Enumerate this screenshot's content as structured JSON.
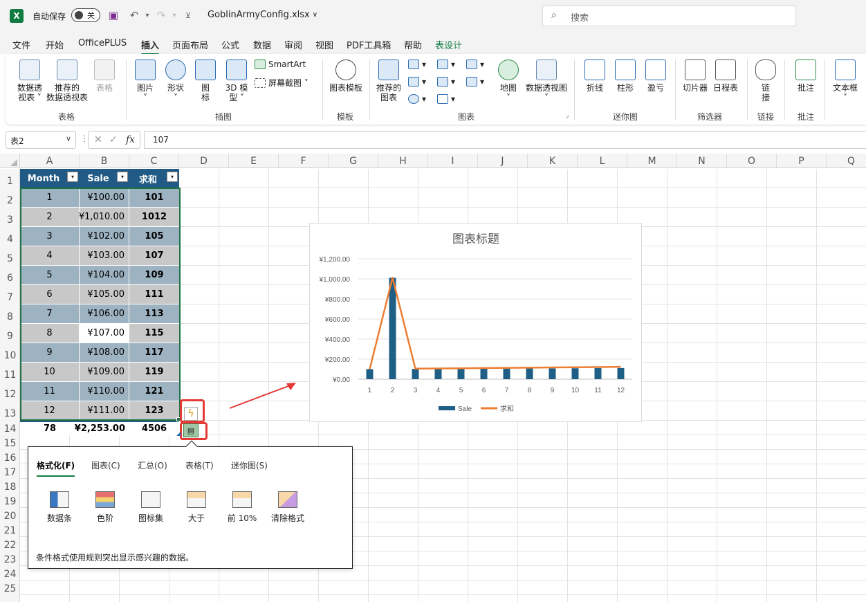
{
  "titlebar": {
    "logo": "X",
    "autosave_label": "自动保存",
    "autosave_state": "关",
    "filename": "GoblinArmyConfig.xlsx",
    "filename_chevron": "∨",
    "search_placeholder": "搜索"
  },
  "menu": {
    "tabs": [
      "文件",
      "开始",
      "OfficePLUS",
      "插入",
      "页面布局",
      "公式",
      "数据",
      "审阅",
      "视图",
      "PDF工具箱",
      "帮助",
      "表设计"
    ],
    "active": "插入"
  },
  "ribbon": {
    "groups": {
      "tables": "表格",
      "illustrations": "插图",
      "templates": "模板",
      "charts": "图表",
      "sparklines": "迷你图",
      "filters": "筛选器",
      "links": "链接",
      "comments": "批注"
    },
    "buttons": {
      "pivot_table": "数据透\n视表 ˅",
      "recommended_pivot": "推荐的\n数据透视表",
      "table": "表格",
      "pictures": "图片\n˅",
      "shapes": "形状\n˅",
      "icons": "图\n标",
      "models_3d": "3D 模\n型 ˅",
      "smartart": "SmartArt",
      "screenshot": "屏幕截图 ˅",
      "chart_templates": "图表模板",
      "recommended_charts": "推荐的\n图表",
      "maps": "地图\n˅",
      "pivot_chart": "数据透视图\n˅",
      "line": "折线",
      "column": "柱形",
      "win_loss": "盈亏",
      "slicer": "切片器",
      "timeline": "日程表",
      "link": "链\n接",
      "comment": "批注",
      "textbox": "文本框\n˅"
    }
  },
  "formula_bar": {
    "name_box": "表2",
    "name_box_arrow": "∨",
    "cancel": "✕",
    "enter": "✓",
    "fx": "fx",
    "value": "107"
  },
  "columns": [
    "A",
    "B",
    "C",
    "D",
    "E",
    "F",
    "G",
    "H",
    "I",
    "J",
    "K",
    "L",
    "M",
    "N",
    "O",
    "P",
    "Q"
  ],
  "rows": [
    "1",
    "2",
    "3",
    "4",
    "5",
    "6",
    "7",
    "8",
    "9",
    "10",
    "11",
    "12",
    "13",
    "14",
    "15",
    "16",
    "17",
    "18",
    "19",
    "20",
    "21",
    "22",
    "23",
    "24",
    "25"
  ],
  "table": {
    "headers": [
      "Month",
      "Sale",
      "求和"
    ],
    "filter_glyph": "▾",
    "rows": [
      [
        "1",
        "¥100.00",
        "101"
      ],
      [
        "2",
        "¥1,010.00",
        "1012"
      ],
      [
        "3",
        "¥102.00",
        "105"
      ],
      [
        "4",
        "¥103.00",
        "107"
      ],
      [
        "5",
        "¥104.00",
        "109"
      ],
      [
        "6",
        "¥105.00",
        "111"
      ],
      [
        "7",
        "¥106.00",
        "113"
      ],
      [
        "8",
        "¥107.00",
        "115"
      ],
      [
        "9",
        "¥108.00",
        "117"
      ],
      [
        "10",
        "¥109.00",
        "119"
      ],
      [
        "11",
        "¥110.00",
        "121"
      ],
      [
        "12",
        "¥111.00",
        "123"
      ]
    ],
    "totals": [
      "78",
      "¥2,253.00",
      "4506"
    ],
    "colors": {
      "header": "#215a84",
      "band_a": "#9eb3c2",
      "band_b": "#c8c8c8",
      "selected": "#ffffff"
    }
  },
  "quick_analysis_buttons": {
    "flash_icon": "lightning-icon",
    "qa_icon": "quick-analysis-icon",
    "highlight_color": "#e53935"
  },
  "chart_data": {
    "type": "bar",
    "title": "图表标题",
    "categories": [
      "1",
      "2",
      "3",
      "4",
      "5",
      "6",
      "7",
      "8",
      "9",
      "10",
      "11",
      "12"
    ],
    "series": [
      {
        "name": "Sale",
        "type": "bar",
        "color": "#1f5f86",
        "values": [
          100,
          1010,
          102,
          103,
          104,
          105,
          106,
          107,
          108,
          109,
          110,
          111
        ]
      },
      {
        "name": "求和",
        "type": "line",
        "color": "#ed7d31",
        "values": [
          101,
          1012,
          105,
          107,
          109,
          111,
          113,
          115,
          117,
          119,
          121,
          123
        ]
      }
    ],
    "ylim": [
      0,
      1200
    ],
    "yticks": [
      "¥0.00",
      "¥200.00",
      "¥400.00",
      "¥600.00",
      "¥800.00",
      "¥1,000.00",
      "¥1,200.00"
    ],
    "grid": true,
    "legend": "bottom"
  },
  "qa_panel": {
    "tabs": [
      "格式化(F)",
      "图表(C)",
      "汇总(O)",
      "表格(T)",
      "迷你图(S)"
    ],
    "active_tab": "格式化(F)",
    "items": [
      "数据条",
      "色阶",
      "图标集",
      "大于",
      "前 10%",
      "清除格式"
    ],
    "item_icons": [
      "data-bars-icon",
      "color-scale-icon",
      "icon-set-icon",
      "greater-than-icon",
      "top-10-icon",
      "clear-format-icon"
    ],
    "description": "条件格式使用规则突出显示感兴趣的数据。"
  }
}
